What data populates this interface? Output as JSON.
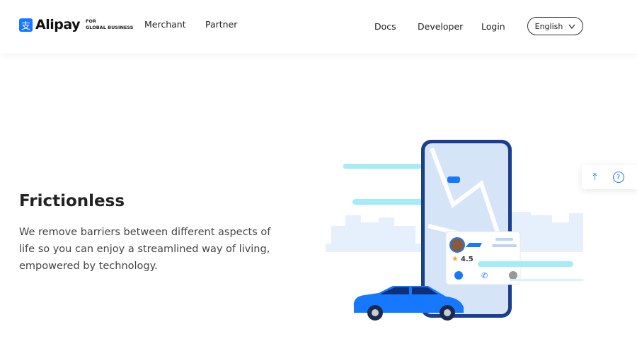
{
  "header": {
    "logo": {
      "word": "Alipay",
      "sub_line1": "FOR",
      "sub_line2": "GLOBAL BUSINESS",
      "glyph": "支"
    },
    "nav_left": [
      {
        "label": "Merchant"
      },
      {
        "label": "Partner"
      }
    ],
    "nav_right": [
      {
        "label": "Docs"
      },
      {
        "label": "Developer"
      },
      {
        "label": "Login"
      }
    ],
    "language": {
      "selected": "English",
      "icon": "chevron-down-icon"
    }
  },
  "hero": {
    "title": "Frictionless",
    "text": "We remove barriers between different aspects of life so you can enjoy a streamlined way of living, empowered by technology."
  },
  "illustration": {
    "rating": "4.5"
  },
  "floating": {
    "top_icon": "back-to-top-icon",
    "help_icon": "help-icon",
    "top_glyph": "⤒",
    "help_glyph": "?"
  },
  "colors": {
    "accent": "#1677ff",
    "phone": "#1a3f8f",
    "light": "#e6effc"
  }
}
